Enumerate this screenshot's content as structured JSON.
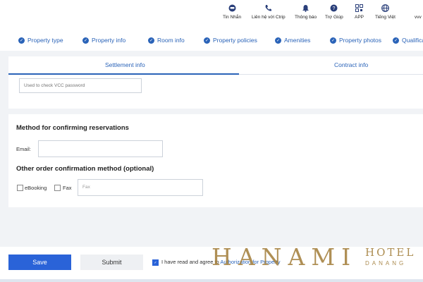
{
  "topbar": {
    "items": [
      {
        "label": "Tin Nhắn",
        "icon": "chat-icon"
      },
      {
        "label": "Liên hệ với Ctrip",
        "icon": "phone-icon"
      },
      {
        "label": "Thông báo",
        "icon": "bell-icon"
      },
      {
        "label": "Trợ Giúp",
        "icon": "help-icon"
      },
      {
        "label": "APP",
        "icon": "qr-code-icon"
      },
      {
        "label": "Tiếng Việt",
        "icon": "globe-icon"
      },
      {
        "label": "vvv",
        "icon": ""
      }
    ]
  },
  "steps": [
    "Property type",
    "Property info",
    "Room info",
    "Property policies",
    "Amenities",
    "Property photos",
    "Qualifica"
  ],
  "tabs": {
    "settlement": "Settlement info",
    "contract": "Contract info"
  },
  "vcc": {
    "placeholder": "Used to check VCC password"
  },
  "reservation": {
    "title": "Method for confirming reservations",
    "email_label": "Email:",
    "email_value": "",
    "other_title": "Other order confirmation method (optional)",
    "ebooking_label": "eBooking",
    "fax_label": "Fax",
    "fax_placeholder": "Fax"
  },
  "footer": {
    "save_label": "Save",
    "submit_label": "Submit",
    "agree_text": "I have read and agree to",
    "agree_link": "Authorization for Property"
  },
  "logo": {
    "main": "HANAMI",
    "hotel": "HOTEL",
    "city": "DANANG"
  },
  "colors": {
    "accent": "#2a63b8",
    "primary_button": "#2a63d8",
    "logo_gold": "#a4803e"
  }
}
